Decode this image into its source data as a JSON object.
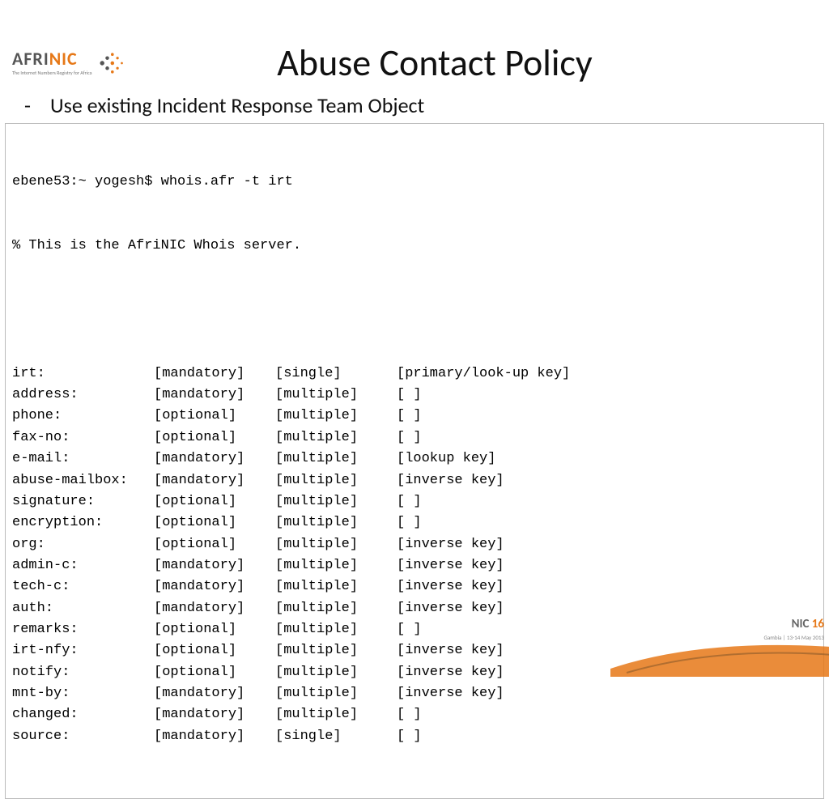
{
  "logo": {
    "brand_a": "AFRI",
    "brand_b": "NIC",
    "tagline": "The Internet Numbers Registry for Africa"
  },
  "title": "Abuse Contact Policy",
  "bullet": {
    "dash": "-",
    "text": "Use existing Incident Response Team Object"
  },
  "terminal": {
    "line1": "ebene53:~ yogesh$ whois.afr -t irt",
    "line2": "% This is the AfriNIC Whois server."
  },
  "schema": [
    {
      "name": "irt:",
      "req": "[mandatory]",
      "card": "[single]",
      "key": "[primary/look-up key]"
    },
    {
      "name": "address:",
      "req": "[mandatory]",
      "card": "[multiple]",
      "key": "[ ]"
    },
    {
      "name": "phone:",
      "req": "[optional]",
      "card": "[multiple]",
      "key": "[ ]"
    },
    {
      "name": "fax-no:",
      "req": "[optional]",
      "card": "[multiple]",
      "key": "[ ]"
    },
    {
      "name": "e-mail:",
      "req": "[mandatory]",
      "card": "[multiple]",
      "key": "[lookup key]"
    },
    {
      "name": "abuse-mailbox:",
      "req": "[mandatory]",
      "card": "[multiple]",
      "key": "[inverse key]"
    },
    {
      "name": "signature:",
      "req": "[optional]",
      "card": "[multiple]",
      "key": "[ ]"
    },
    {
      "name": "encryption:",
      "req": "[optional]",
      "card": "[multiple]",
      "key": "[ ]"
    },
    {
      "name": "org:",
      "req": "[optional]",
      "card": "[multiple]",
      "key": "[inverse key]"
    },
    {
      "name": "admin-c:",
      "req": "[mandatory]",
      "card": "[multiple]",
      "key": "[inverse key]"
    },
    {
      "name": "tech-c:",
      "req": "[mandatory]",
      "card": "[multiple]",
      "key": "[inverse key]"
    },
    {
      "name": "auth:",
      "req": "[mandatory]",
      "card": "[multiple]",
      "key": "[inverse key]"
    },
    {
      "name": "remarks:",
      "req": "[optional]",
      "card": "[multiple]",
      "key": "[ ]"
    },
    {
      "name": "irt-nfy:",
      "req": "[optional]",
      "card": "[multiple]",
      "key": "[inverse key]"
    },
    {
      "name": "notify:",
      "req": "[optional]",
      "card": "[multiple]",
      "key": "[inverse key]"
    },
    {
      "name": "mnt-by:",
      "req": "[mandatory]",
      "card": "[multiple]",
      "key": "[inverse key]"
    },
    {
      "name": "changed:",
      "req": "[mandatory]",
      "card": "[multiple]",
      "key": "[ ]"
    },
    {
      "name": "source:",
      "req": "[mandatory]",
      "card": "[single]",
      "key": "[ ]"
    }
  ],
  "footer": {
    "nic": "NIC ",
    "num": "16",
    "sub": "Gambia | 13-14 May 2013"
  }
}
